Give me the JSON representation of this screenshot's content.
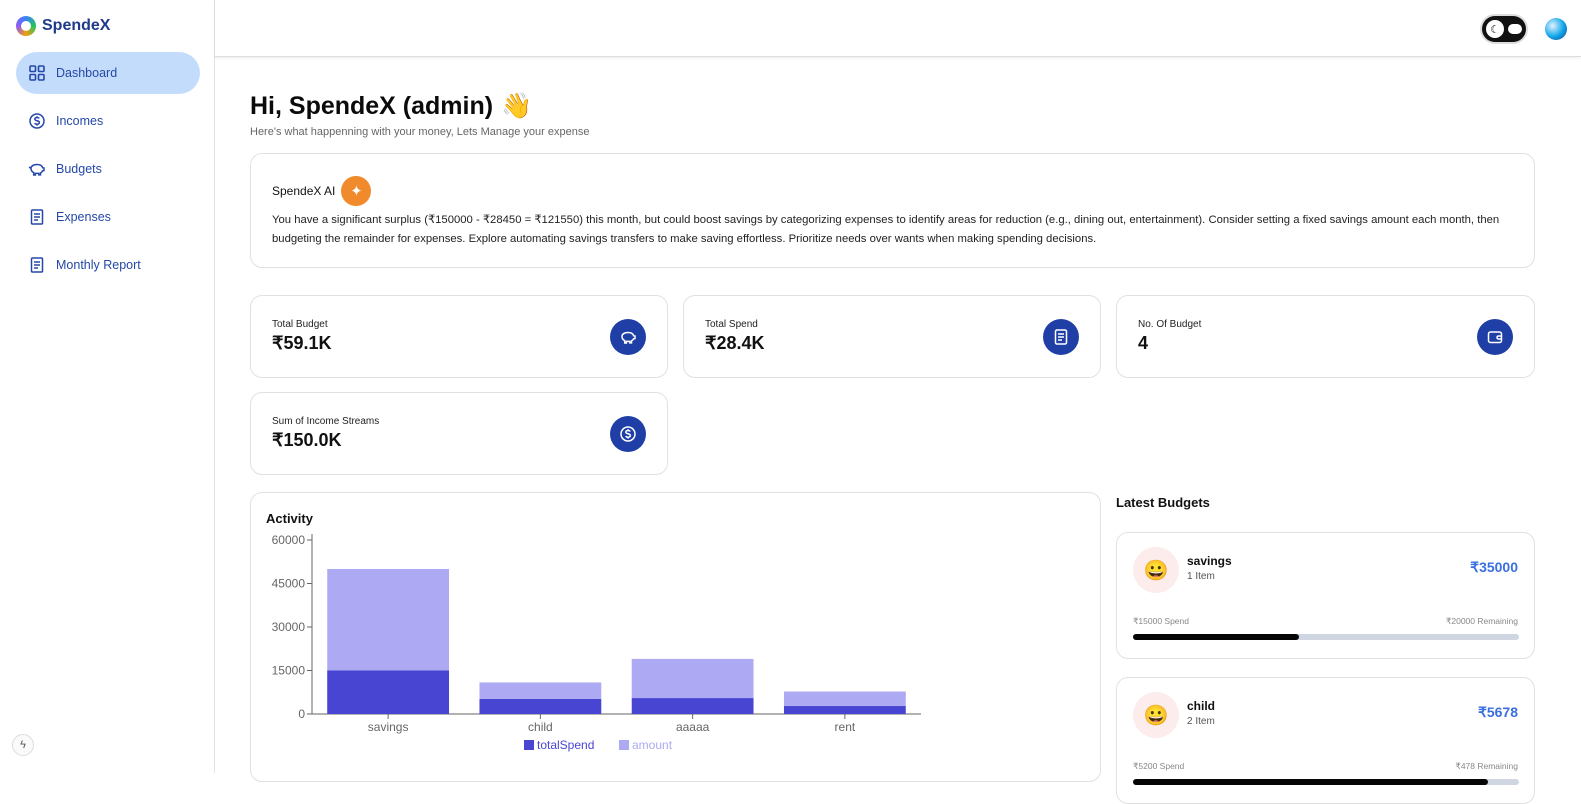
{
  "app": {
    "name": "SpendeX"
  },
  "sidebar": {
    "items": [
      {
        "label": "Dashboard",
        "icon": "grid-icon",
        "active": true
      },
      {
        "label": "Incomes",
        "icon": "dollar-circle-icon"
      },
      {
        "label": "Budgets",
        "icon": "piggy-bank-icon"
      },
      {
        "label": "Expenses",
        "icon": "receipt-icon"
      },
      {
        "label": "Monthly Report",
        "icon": "report-icon"
      }
    ]
  },
  "header": {
    "greeting": "Hi, SpendeX (admin)",
    "wave": "👋",
    "subtitle": "Here's what happenning with your money, Lets Manage your expense"
  },
  "ai": {
    "title": "SpendeX AI",
    "text": "You have a significant surplus (₹150000 - ₹28450 = ₹121550) this month, but could boost savings by categorizing expenses to identify areas for reduction (e.g., dining out, entertainment). Consider setting a fixed savings amount each month, then budgeting the remainder for expenses. Explore automating savings transfers to make saving effortless. Prioritize needs over wants when making spending decisions."
  },
  "stats": [
    {
      "label": "Total Budget",
      "value": "₹59.1K",
      "icon": "piggy-bank-icon"
    },
    {
      "label": "Total Spend",
      "value": "₹28.4K",
      "icon": "receipt-icon"
    },
    {
      "label": "No. Of Budget",
      "value": "4",
      "icon": "wallet-icon"
    },
    {
      "label": "Sum of Income Streams",
      "value": "₹150.0K",
      "icon": "dollar-circle-icon"
    }
  ],
  "activity": {
    "title": "Activity"
  },
  "chart_data": {
    "type": "bar",
    "stacked": true,
    "categories": [
      "savings",
      "child",
      "aaaaa",
      "rent"
    ],
    "series": [
      {
        "name": "totalSpend",
        "values": [
          15000,
          5200,
          5500,
          2750
        ],
        "color": "#4845d3"
      },
      {
        "name": "amount",
        "values": [
          35000,
          5678,
          13500,
          5000
        ],
        "color": "#adaaf3"
      }
    ],
    "yticks": [
      0,
      15000,
      30000,
      45000,
      60000
    ],
    "ylim": [
      0,
      60000
    ],
    "legend": "bottom"
  },
  "latest_budgets": {
    "title": "Latest Budgets",
    "items": [
      {
        "emoji": "😀",
        "name": "savings",
        "items": "1 Item",
        "amount": "₹35000",
        "spend": "₹15000 Spend",
        "remaining": "₹20000 Remaining",
        "progress": 0.43
      },
      {
        "emoji": "😀",
        "name": "child",
        "items": "2 Item",
        "amount": "₹5678",
        "spend": "₹5200 Spend",
        "remaining": "₹478 Remaining",
        "progress": 0.92
      }
    ]
  }
}
